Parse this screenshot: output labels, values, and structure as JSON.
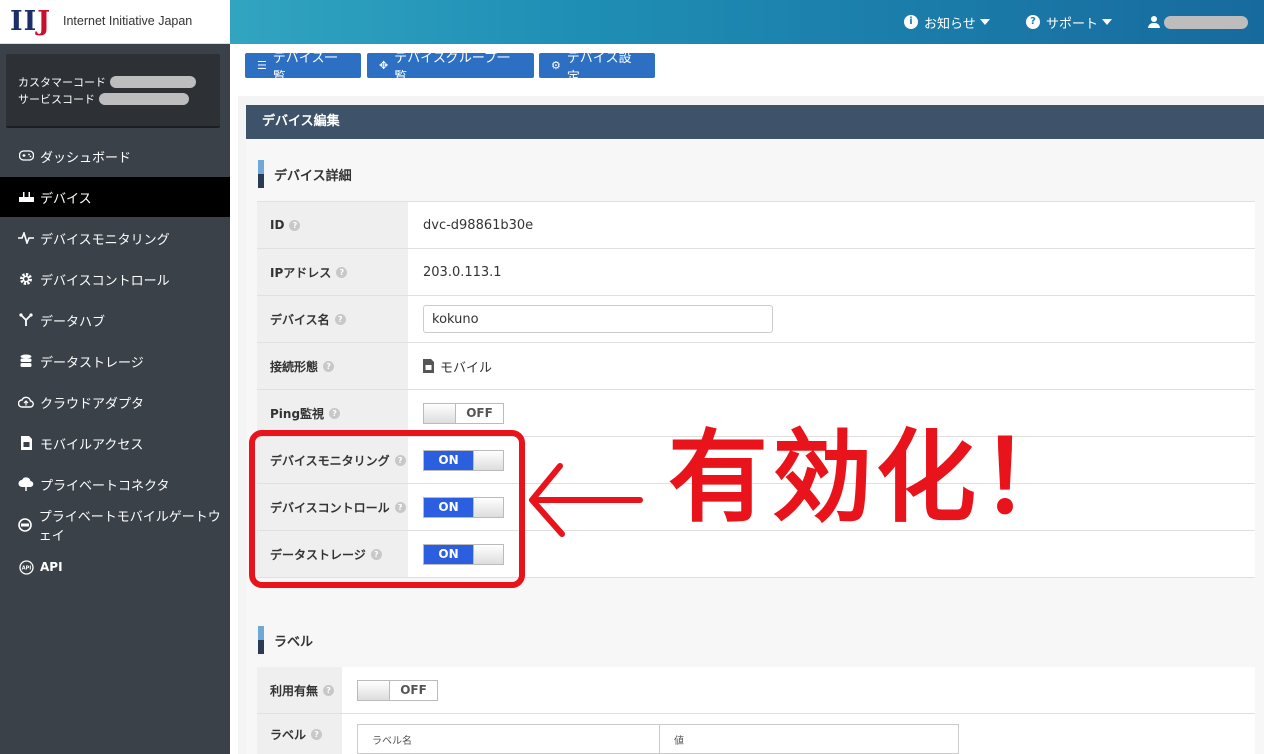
{
  "brand": {
    "logo_mark": "IIJ",
    "logo_text": "Internet Initiative Japan"
  },
  "topnav": {
    "news": "お知らせ",
    "support": "サポート"
  },
  "customer": {
    "customer_code_label": "カスタマーコード",
    "service_code_label": "サービスコード"
  },
  "sidebar": {
    "items": [
      {
        "label": "ダッシュボード",
        "icon": "gamepad-icon"
      },
      {
        "label": "デバイス",
        "icon": "router-icon"
      },
      {
        "label": "デバイスモニタリング",
        "icon": "pulse-icon"
      },
      {
        "label": "デバイスコントロール",
        "icon": "gear-icon"
      },
      {
        "label": "データハブ",
        "icon": "hub-icon"
      },
      {
        "label": "データストレージ",
        "icon": "database-icon"
      },
      {
        "label": "クラウドアダプタ",
        "icon": "cloud-upload-icon"
      },
      {
        "label": "モバイルアクセス",
        "icon": "sim-card-icon"
      },
      {
        "label": "プライベートコネクタ",
        "icon": "connector-icon"
      },
      {
        "label": "プライベートモバイルゲートウェイ",
        "icon": "gateway-icon"
      },
      {
        "label": "API",
        "icon": "api-icon"
      }
    ]
  },
  "tabs": {
    "device_list": "デバイス一覧",
    "device_group_list": "デバイスグループ一覧",
    "device_settings": "デバイス設定"
  },
  "panel": {
    "title": "デバイス編集"
  },
  "details": {
    "title": "デバイス詳細",
    "id_label": "ID",
    "id_value": "dvc-d98861b30e",
    "ip_label": "IPアドレス",
    "ip_value": "203.0.113.1",
    "name_label": "デバイス名",
    "name_value": "kokuno",
    "conn_label": "接続形態",
    "conn_value": "モバイル",
    "ping_label": "Ping監視",
    "ping_value": "OFF",
    "monitoring_label": "デバイスモニタリング",
    "monitoring_value": "ON",
    "control_label": "デバイスコントロール",
    "control_value": "ON",
    "storage_label": "データストレージ",
    "storage_value": "ON"
  },
  "label_section": {
    "title": "ラベル",
    "use_label": "利用有無",
    "use_value": "OFF",
    "label_label": "ラベル",
    "col_name": "ラベル名",
    "col_value": "値"
  },
  "annotation": {
    "text": "有効化！",
    "color": "#e8131b"
  }
}
